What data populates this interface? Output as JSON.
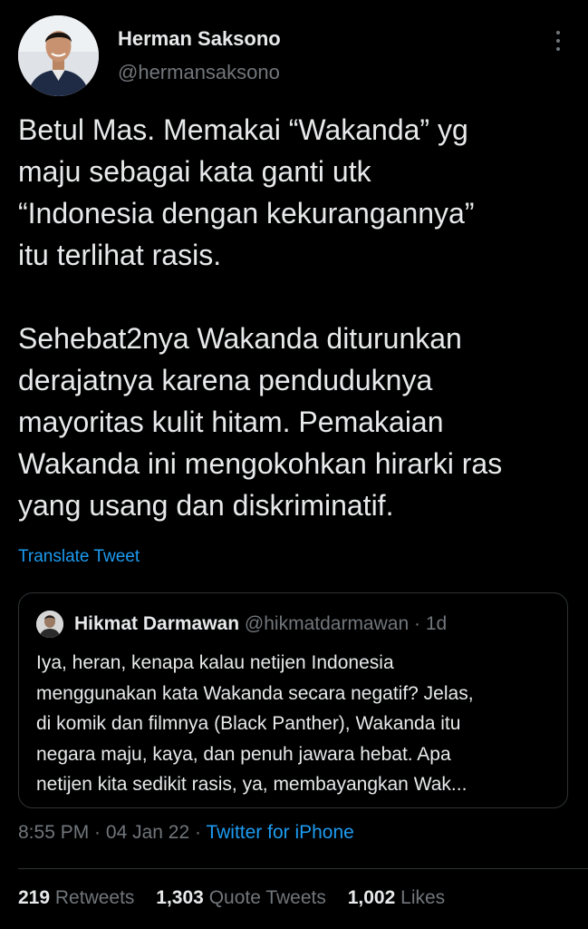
{
  "author": {
    "name": "Herman Saksono",
    "handle": "@hermansaksono"
  },
  "tweet": {
    "lines": [
      "Betul Mas. Memakai “Wakanda” yg",
      "maju sebagai kata ganti utk",
      "“Indonesia dengan kekurangannya”",
      "itu terlihat rasis.",
      "Sehebat2nya Wakanda diturunkan",
      "derajatnya karena penduduknya",
      "mayoritas kulit hitam. Pemakaian",
      "Wakanda ini mengokohkan hirarki ras",
      "yang usang dan diskriminatif."
    ],
    "translate_label": "Translate Tweet"
  },
  "quoted": {
    "name": "Hikmat Darmawan",
    "handle": "@hikmatdarmawan",
    "separator": " · ",
    "age": "1d",
    "lines": [
      "Iya, heran, kenapa kalau netijen Indonesia",
      "menggunakan kata Wakanda secara negatif? Jelas,",
      "di komik dan filmnya (Black Panther), Wakanda itu",
      "negara maju, kaya, dan penuh jawara hebat. Apa",
      "netijen kita sedikit rasis, ya, membayangkan Wak..."
    ]
  },
  "meta": {
    "time": "8:55 PM",
    "sep1": " · ",
    "date": "04 Jan 22",
    "sep2": " · ",
    "source": "Twitter for iPhone"
  },
  "stats": {
    "retweets": {
      "count": "219",
      "label": "Retweets"
    },
    "quotes": {
      "count": "1,303",
      "label": "Quote Tweets"
    },
    "likes": {
      "count": "1,002",
      "label": "Likes"
    }
  },
  "icons": {
    "more": "more-vertical-icon"
  },
  "colors": {
    "background": "#000000",
    "text": "#e7e9ea",
    "secondary": "#71767b",
    "accent": "#1d9bf0",
    "border": "#2f3336"
  }
}
